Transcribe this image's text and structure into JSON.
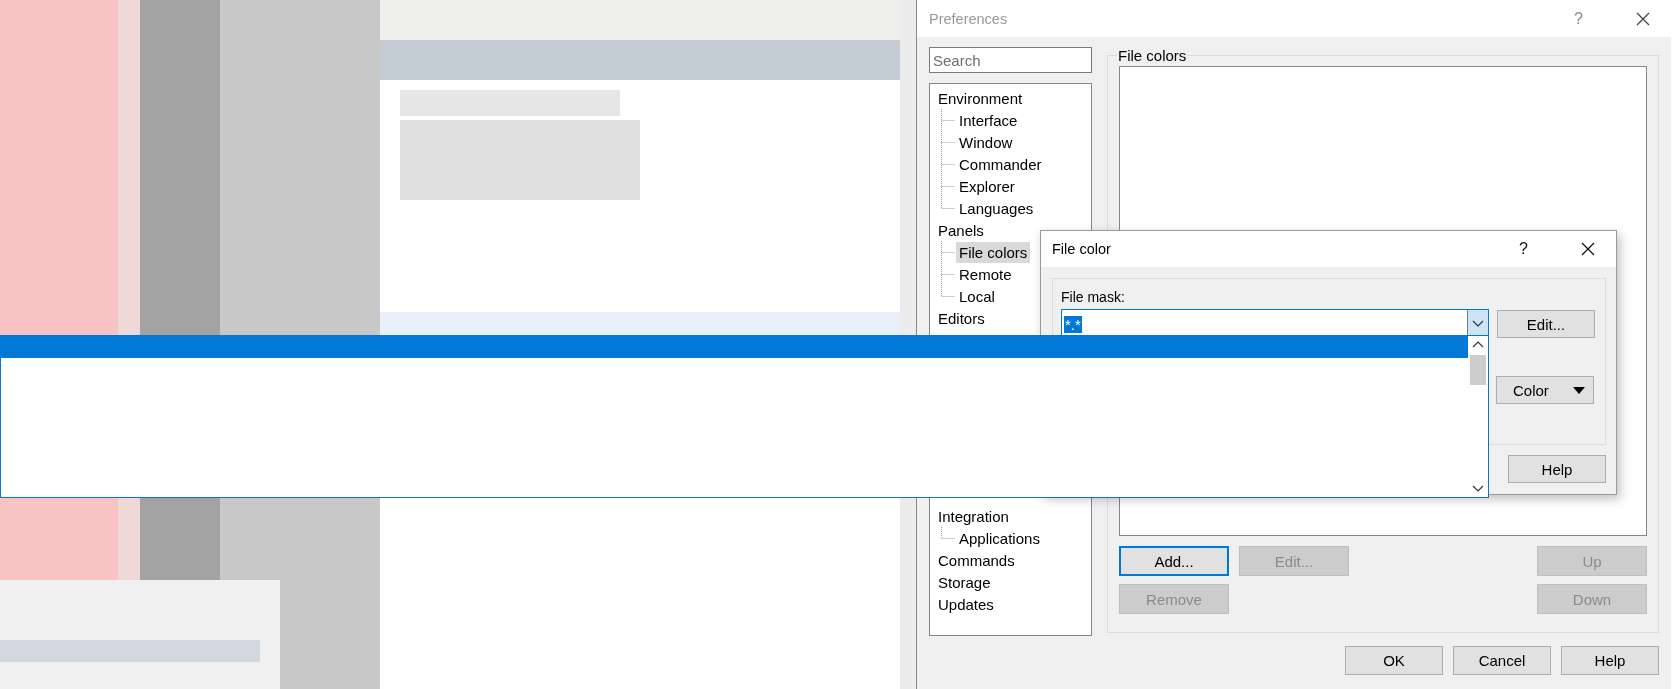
{
  "window": {
    "title": "Preferences",
    "help_glyph": "?",
    "search": {
      "placeholder": "Search"
    },
    "tree": [
      {
        "label": "Environment",
        "selected": false,
        "children": [
          {
            "label": "Interface",
            "selected": false
          },
          {
            "label": "Window",
            "selected": false
          },
          {
            "label": "Commander",
            "selected": false
          },
          {
            "label": "Explorer",
            "selected": false
          },
          {
            "label": "Languages",
            "selected": false
          }
        ]
      },
      {
        "label": "Panels",
        "selected": false,
        "children": [
          {
            "label": "File colors",
            "selected": true
          },
          {
            "label": "Remote",
            "selected": false
          },
          {
            "label": "Local",
            "selected": false
          }
        ]
      },
      {
        "label": "Editors",
        "selected": false
      },
      {
        "label": "Integration",
        "selected": false,
        "children": [
          {
            "label": "Applications",
            "selected": false
          }
        ]
      },
      {
        "label": "Commands",
        "selected": false
      },
      {
        "label": "Storage",
        "selected": false
      },
      {
        "label": "Updates",
        "selected": false
      }
    ],
    "group": {
      "title": "File colors"
    },
    "button_rows": [
      {
        "left": [
          {
            "label": "Add...",
            "disabled": false,
            "focused": true
          },
          {
            "label": "Edit...",
            "disabled": true,
            "focused": false
          }
        ],
        "right": [
          {
            "label": "Up",
            "disabled": true,
            "focused": false
          }
        ]
      },
      {
        "left": [
          {
            "label": "Remove",
            "disabled": true,
            "focused": false
          }
        ],
        "right": [
          {
            "label": "Down",
            "disabled": true,
            "focused": false
          }
        ]
      }
    ],
    "buttons": [
      {
        "label": "OK"
      },
      {
        "label": "Cancel"
      },
      {
        "label": "Help"
      }
    ]
  },
  "dialog": {
    "title": "File color",
    "help_glyph": "?",
    "mask_label": "File mask:",
    "mask_value": "*.*",
    "mask_expanded": true,
    "edit_button": "Edit...",
    "color_button": "Color",
    "buttons": [
      {
        "label": "Help"
      }
    ]
  }
}
